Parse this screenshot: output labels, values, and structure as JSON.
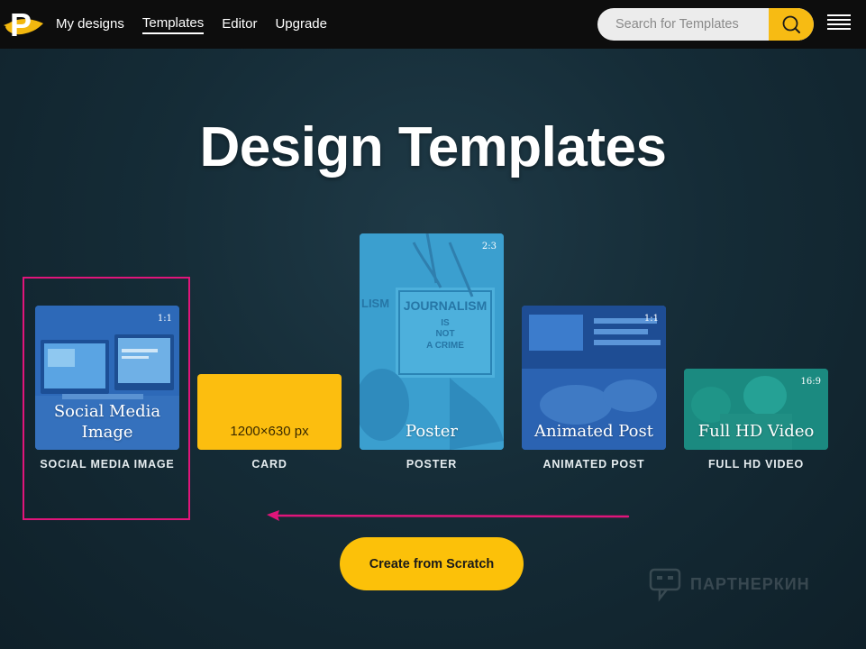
{
  "nav": {
    "logo_letter": "P",
    "items": [
      {
        "label": "My designs",
        "active": false
      },
      {
        "label": "Templates",
        "active": true
      },
      {
        "label": "Editor",
        "active": false
      },
      {
        "label": "Upgrade",
        "active": false
      }
    ]
  },
  "search": {
    "placeholder": "Search for Templates"
  },
  "page_title": "Design Templates",
  "cards": [
    {
      "title": "Social Media Image",
      "ratio": "1:1",
      "label": "SOCIAL MEDIA IMAGE"
    },
    {
      "title": "1200×630 px",
      "ratio": "",
      "label": "CARD"
    },
    {
      "title": "Poster",
      "ratio": "2:3",
      "label": "POSTER"
    },
    {
      "title": "Animated Post",
      "ratio": "1:1",
      "label": "ANIMATED POST"
    },
    {
      "title": "Full HD Video",
      "ratio": "16:9",
      "label": "FULL HD VIDEO"
    }
  ],
  "poster_art_text": [
    "JOURNALISM",
    "IS",
    "NOT",
    "A CRIME",
    "LISM"
  ],
  "cta_label": "Create from Scratch",
  "watermark": "ПАРТНЕРКИН",
  "colors": {
    "accent": "#fcc109",
    "highlight": "#e0157a",
    "topbar": "#0d0d0d"
  }
}
